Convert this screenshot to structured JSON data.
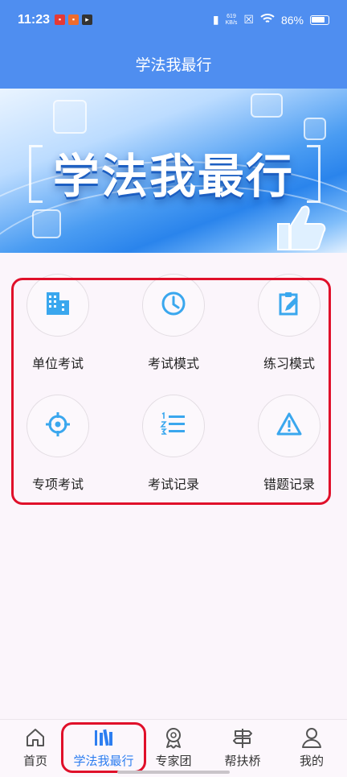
{
  "status": {
    "time": "11:23",
    "speed_value": "619",
    "speed_unit": "KB/s",
    "battery": "86%"
  },
  "header": {
    "title": "学法我最行"
  },
  "banner": {
    "title": "学法我最行"
  },
  "colors": {
    "primary": "#4f8ef0",
    "accent": "#2d7ef0",
    "icon": "#3aa7ee",
    "highlight": "#e0102a"
  },
  "menu": {
    "items": [
      {
        "label": "单位考试",
        "icon": "building-icon"
      },
      {
        "label": "考试模式",
        "icon": "clock-icon"
      },
      {
        "label": "练习模式",
        "icon": "clipboard-edit-icon"
      },
      {
        "label": "专项考试",
        "icon": "crosshair-icon"
      },
      {
        "label": "考试记录",
        "icon": "numbered-list-icon"
      },
      {
        "label": "错题记录",
        "icon": "warning-icon"
      }
    ]
  },
  "tabbar": {
    "items": [
      {
        "label": "首页",
        "icon": "home-icon"
      },
      {
        "label": "学法我最行",
        "icon": "books-icon",
        "active": true
      },
      {
        "label": "专家团",
        "icon": "award-icon"
      },
      {
        "label": "帮扶桥",
        "icon": "signpost-icon"
      },
      {
        "label": "我的",
        "icon": "user-icon"
      }
    ]
  }
}
